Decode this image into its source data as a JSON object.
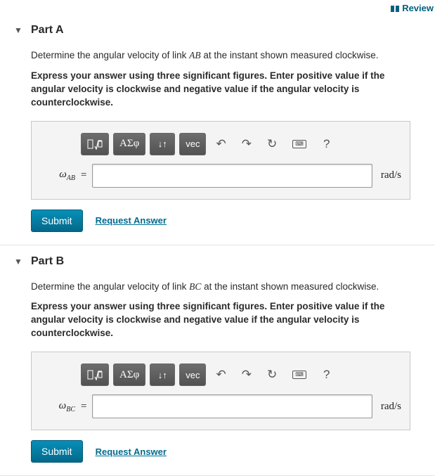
{
  "top": {
    "review": "Review"
  },
  "toolbar": {
    "greek": "ΑΣφ",
    "updown": "↓↑",
    "vec": "vec",
    "undo_icon": "↶",
    "redo_icon": "↷",
    "reset_icon": "↻",
    "help_icon": "?"
  },
  "action": {
    "submit": "Submit",
    "request": "Request Answer"
  },
  "partA": {
    "title": "Part A",
    "question_pre": "Determine the angular velocity of link ",
    "question_link": "AB",
    "question_post": " at the instant shown measured clockwise.",
    "instruction": "Express your answer using three significant figures. Enter positive value if the angular velocity is clockwise and negative value if the angular velocity is counterclockwise.",
    "var_sym": "ω",
    "var_sub": "AB",
    "eq": "=",
    "value": "",
    "unit": "rad/s"
  },
  "partB": {
    "title": "Part B",
    "question_pre": "Determine the angular velocity of link ",
    "question_link": "BC",
    "question_post": " at the instant shown measured clockwise.",
    "instruction": "Express your answer using three significant figures. Enter positive value if the angular velocity is clockwise and negative value if the angular velocity is counterclockwise.",
    "var_sym": "ω",
    "var_sub": "BC",
    "eq": "=",
    "value": "",
    "unit": "rad/s"
  }
}
